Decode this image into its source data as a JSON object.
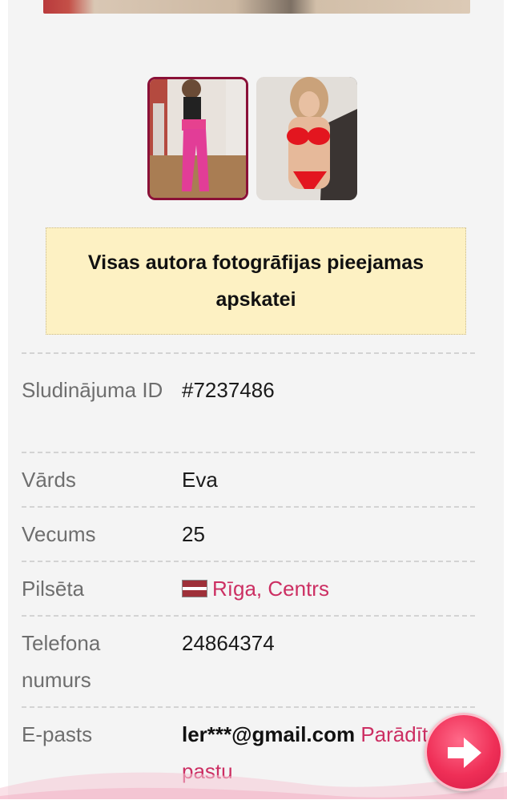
{
  "gallery": {
    "thumbs": [
      {
        "name": "thumb-photo-1",
        "selected": true
      },
      {
        "name": "thumb-photo-2",
        "selected": false
      }
    ]
  },
  "notice": {
    "text": "Visas autora fotogrāfijas pieejamas apskatei"
  },
  "details": {
    "id": {
      "label": "Sludinājuma ID",
      "value": "#7237486"
    },
    "name": {
      "label": "Vārds",
      "value": "Eva"
    },
    "age": {
      "label": "Vecums",
      "value": "25"
    },
    "city": {
      "label": "Pilsēta",
      "value": "Rīga, Centrs",
      "flag": "latvia-flag-icon"
    },
    "phone": {
      "label": "Telefona numurs",
      "value": "24864374"
    },
    "email": {
      "label": "E-pasts",
      "value": "ler***@gmail.com",
      "link": "Parādīt pastu"
    }
  },
  "fab": {
    "icon": "arrow-right-icon"
  },
  "colors": {
    "accent": "#cc2e62",
    "notice_bg": "#fdf1c3",
    "selected_border": "#8a1037"
  }
}
